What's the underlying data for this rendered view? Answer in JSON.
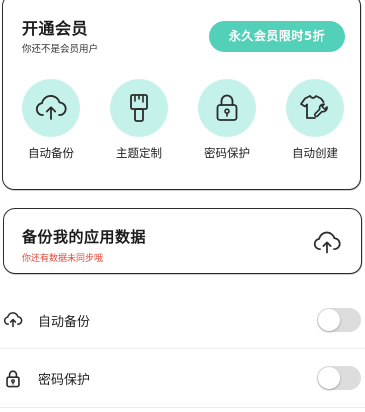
{
  "member": {
    "title": "开通会员",
    "subtitle": "你还不是会员用户",
    "vip_button": "永久会员限时5折"
  },
  "features": [
    {
      "label": "自动备份",
      "icon": "cloud-upload-icon"
    },
    {
      "label": "主题定制",
      "icon": "paint-brush-icon"
    },
    {
      "label": "密码保护",
      "icon": "lock-icon"
    },
    {
      "label": "自动创建",
      "icon": "shirt-wrench-icon"
    }
  ],
  "backup": {
    "title": "备份我的应用数据",
    "subtitle": "你还有数据未同步哦",
    "icon": "cloud-upload-icon"
  },
  "settings": [
    {
      "label": "自动备份",
      "icon": "cloud-upload-icon",
      "enabled": false
    },
    {
      "label": "密码保护",
      "icon": "lock-icon",
      "enabled": false
    }
  ],
  "colors": {
    "accent": "#52d1b8",
    "icon_bg": "#c4f2ea",
    "warning_text": "#e0483a",
    "toggle_off": "#dcdcdc"
  }
}
